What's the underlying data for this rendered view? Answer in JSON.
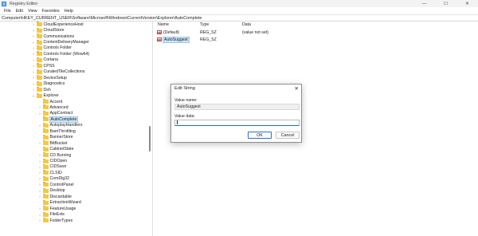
{
  "window": {
    "title": "Registry Editor",
    "controls": {
      "minimize": "—",
      "maximize": "☐",
      "close": "✕"
    }
  },
  "menu": [
    "File",
    "Edit",
    "View",
    "Favorites",
    "Help"
  ],
  "address": "Computer\\HKEY_CURRENT_USER\\Software\\Microsoft\\Windows\\CurrentVersion\\Explorer\\AutoComplete",
  "tree": [
    {
      "label": "CloudExperienceHost",
      "depth": 0,
      "chev": "right"
    },
    {
      "label": "CloudStore",
      "depth": 0,
      "chev": "right"
    },
    {
      "label": "Communications",
      "depth": 0,
      "chev": "right"
    },
    {
      "label": "ContentDeliveryManager",
      "depth": 0,
      "chev": "right"
    },
    {
      "label": "Controls Folder",
      "depth": 0,
      "chev": "right"
    },
    {
      "label": "Controls Folder (Wow64)",
      "depth": 0,
      "chev": "right"
    },
    {
      "label": "Cortana",
      "depth": 0,
      "chev": "right"
    },
    {
      "label": "CPSS",
      "depth": 0,
      "chev": "right"
    },
    {
      "label": "CuratedTileCollections",
      "depth": 0,
      "chev": "right"
    },
    {
      "label": "DeviceSetup",
      "depth": 0,
      "chev": "right"
    },
    {
      "label": "Diagnostics",
      "depth": 0,
      "chev": "right"
    },
    {
      "label": "Dsh",
      "depth": 0,
      "chev": "right"
    },
    {
      "label": "Explorer",
      "depth": 0,
      "chev": "down"
    },
    {
      "label": "Accent",
      "depth": 1,
      "chev": ""
    },
    {
      "label": "Advanced",
      "depth": 1,
      "chev": "right"
    },
    {
      "label": "AppContract",
      "depth": 1,
      "chev": "right"
    },
    {
      "label": "AutoComplete",
      "depth": 1,
      "chev": "",
      "selected": true
    },
    {
      "label": "AutoplayHandlers",
      "depth": 1,
      "chev": "right"
    },
    {
      "label": "BamThrottling",
      "depth": 1,
      "chev": ""
    },
    {
      "label": "BannerStore",
      "depth": 1,
      "chev": ""
    },
    {
      "label": "BitBucket",
      "depth": 1,
      "chev": "right"
    },
    {
      "label": "CabinetState",
      "depth": 1,
      "chev": ""
    },
    {
      "label": "CD Burning",
      "depth": 1,
      "chev": "right"
    },
    {
      "label": "CIDOpen",
      "depth": 1,
      "chev": "right"
    },
    {
      "label": "CIDSave",
      "depth": 1,
      "chev": "right"
    },
    {
      "label": "CLSID",
      "depth": 1,
      "chev": "right"
    },
    {
      "label": "ComDlg32",
      "depth": 1,
      "chev": "right"
    },
    {
      "label": "ControlPanel",
      "depth": 1,
      "chev": "right"
    },
    {
      "label": "Desktop",
      "depth": 1,
      "chev": "right"
    },
    {
      "label": "Discardable",
      "depth": 1,
      "chev": "right"
    },
    {
      "label": "ExtractionWizard",
      "depth": 1,
      "chev": ""
    },
    {
      "label": "FeatureUsage",
      "depth": 1,
      "chev": "right"
    },
    {
      "label": "FileExts",
      "depth": 1,
      "chev": "right"
    },
    {
      "label": "FolderTypes",
      "depth": 1,
      "chev": "right"
    }
  ],
  "list": {
    "columns": {
      "name": "Name",
      "type": "Type",
      "data": "Data"
    },
    "rows": [
      {
        "name": "(Default)",
        "type": "REG_SZ",
        "data": "(value not set)",
        "icon": "ab-string-icon"
      },
      {
        "name": "AutoSuggest",
        "type": "REG_SZ",
        "data": "",
        "icon": "ab-string-icon",
        "selected": true
      }
    ]
  },
  "dialog": {
    "title": "Edit String",
    "close": "✕",
    "value_name_label": "Value name:",
    "value_name": "AutoSuggest",
    "value_data_label": "Value data:",
    "value_data": "",
    "ok": "OK",
    "cancel": "Cancel"
  }
}
